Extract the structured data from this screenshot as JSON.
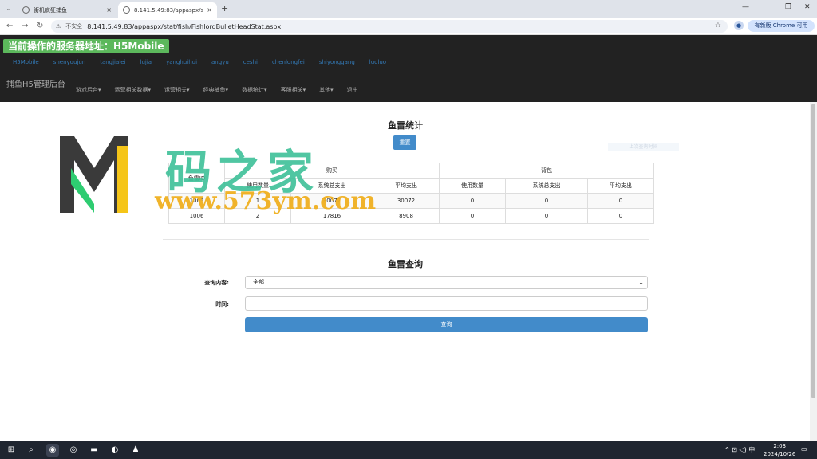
{
  "browser": {
    "tabs": [
      {
        "title": "街机疯狂捕鱼",
        "close": "×"
      },
      {
        "title": "8.141.5.49:83/appaspx/stat/f",
        "close": "×"
      }
    ],
    "new_tab": "+",
    "url_prefix": "不安全",
    "url": "8.141.5.49:83/appaspx/stat/fish/FishlordBulletHeadStat.aspx",
    "update_btn": "有新版 Chrome 可用",
    "win_controls": [
      "⌄",
      "—",
      "❐",
      "✕"
    ]
  },
  "header": {
    "server_label": "当前操作的服务器地址：H5Mobile",
    "servers": [
      "H5Mobile",
      "shenyoujun",
      "tangjialei",
      "lujia",
      "yanghuihui",
      "angyu",
      "ceshi",
      "chenlongfei",
      "shiyonggang",
      "luoluo"
    ],
    "brand": "捕鱼H5管理后台",
    "menu": [
      "游戏后台▾",
      "运营相关数据▾",
      "运营相关▾",
      "经典捕鱼▾",
      "数据统计▾",
      "客服相关▾",
      "其他▾",
      "退出"
    ]
  },
  "stats": {
    "title": "鱼雷统计",
    "reset": "重置",
    "faint_text": "上次查询时间",
    "head": {
      "id": "鱼雷ID",
      "group1": "购买",
      "group2": "背包",
      "cols": [
        "使用数量",
        "系统总支出",
        "平均支出",
        "使用数量",
        "系统总支出",
        "平均支出"
      ]
    },
    "rows": [
      [
        "1005",
        "1",
        "30072",
        "30072",
        "0",
        "0",
        "0"
      ],
      [
        "1006",
        "2",
        "17816",
        "8908",
        "0",
        "0",
        "0"
      ]
    ]
  },
  "query": {
    "title": "鱼雷查询",
    "content_label": "查询内容:",
    "content_value": "全部",
    "time_label": "时间:",
    "button": "查询"
  },
  "watermark": {
    "cn": "码之家",
    "url": "www.573ym.com"
  },
  "taskbar": {
    "time": "2:03",
    "date": "2024/10/26",
    "ime": "中",
    "tray": "^ ⊡ ◁) 中"
  }
}
